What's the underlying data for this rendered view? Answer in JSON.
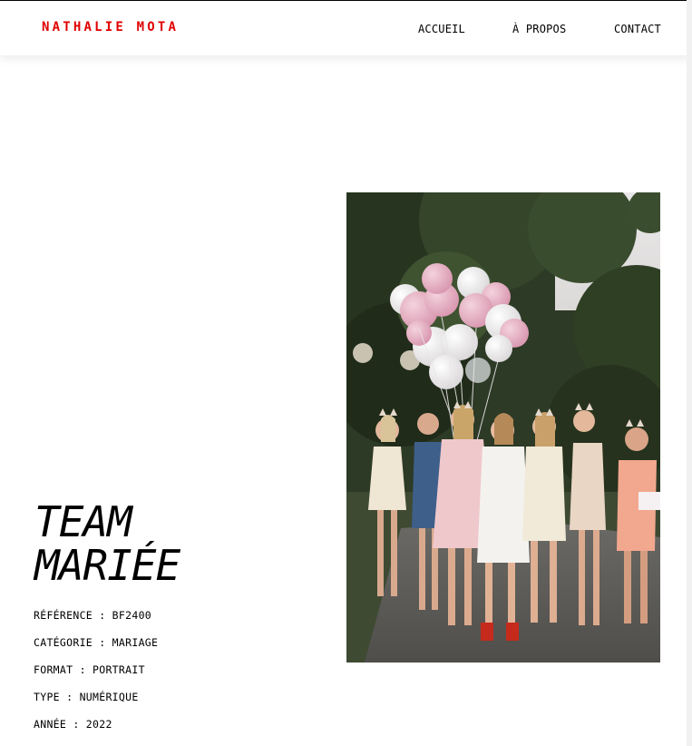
{
  "header": {
    "logo": "NATHALIE MOTA",
    "nav": [
      "ACCUEIL",
      "À PROPOS",
      "CONTACT"
    ]
  },
  "photo": {
    "title_line1": "TEAM",
    "title_line2": "MARIÉE",
    "meta": [
      "RÉFÉRENCE : BF2400",
      "CATÉGORIE : MARIAGE",
      "FORMAT : PORTRAIT",
      "TYPE : NUMÉRIQUE",
      "ANNÉE : 2022"
    ]
  },
  "colors": {
    "accent": "#e00000"
  }
}
